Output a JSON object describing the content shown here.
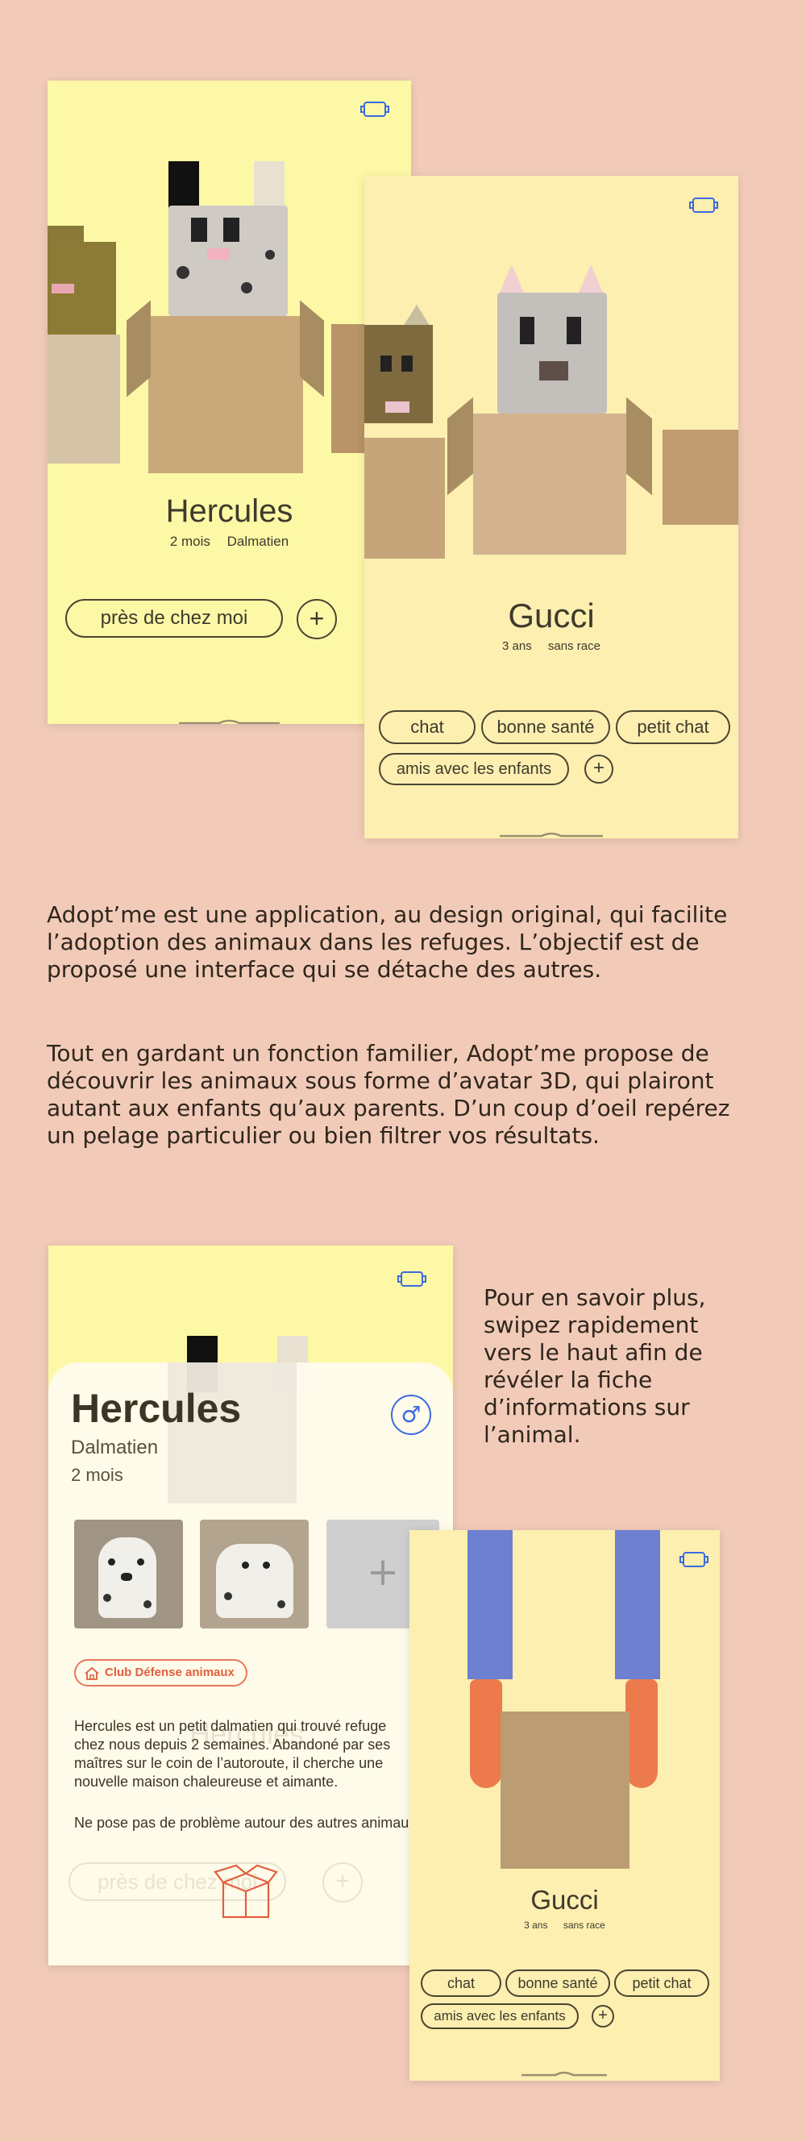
{
  "colors": {
    "background": "#f2cbb8",
    "screen_yellow": "#fdf8a6",
    "screen_cream": "#fcefb0",
    "accent_blue": "#3b6ae0",
    "accent_orange": "#e0603e"
  },
  "screen_a": {
    "icon": "carrier-icon",
    "pet_name": "Hercules",
    "pet_age": "2 mois",
    "pet_breed": "Dalmatien",
    "filter_pill": "près de chez moi",
    "plus": "+"
  },
  "screen_b": {
    "icon": "carrier-icon",
    "pet_name": "Gucci",
    "pet_age": "3 ans",
    "pet_breed": "sans race",
    "tags": [
      "chat",
      "bonne santé",
      "petit chat",
      "amis avec les enfants"
    ],
    "plus": "+"
  },
  "intro": {
    "paragraph1": "Adopt’me est une application, au design original, qui facilite l’adoption des animaux dans les refuges. L’objectif est de proposé une interface qui se détache des autres.",
    "paragraph2": "Tout en gardant un fonction familier, Adopt’me propose de découvrir les animaux sous forme d’avatar 3D, qui plairont autant aux enfants qu’aux parents. D’un coup d’oeil repérez un pelage particulier ou bien filtrer vos résultats."
  },
  "side_note": "Pour en savoir plus, swipez rapidement vers le haut afin de révéler la fiche d’informations sur l’animal.",
  "screen_c": {
    "icon": "carrier-icon",
    "sheet_name": "Hercules",
    "sheet_breed": "Dalmatien",
    "sheet_age": "2 mois",
    "gender_symbol": "♂",
    "add_photo": "+",
    "club_label": "Club Défense animaux",
    "description": "Hercules est un petit dalmatien qui trouvé refuge\nchez nous depuis 2 semaines. Abandoné par ses\nmaîtres sur le coin de l’autoroute, il cherche une\nnouvelle maison chaleureuse et aimante.",
    "description2": "Ne pose pas de problème autour des autres animaux",
    "ghost_filter_pill": "près de chez moi",
    "ghost_name": "Hercules"
  },
  "screen_d": {
    "icon": "carrier-icon",
    "pet_name": "Gucci",
    "pet_age": "3 ans",
    "pet_breed": "sans race",
    "tags": [
      "chat",
      "bonne santé",
      "petit chat",
      "amis avec les enfants"
    ],
    "plus": "+"
  }
}
